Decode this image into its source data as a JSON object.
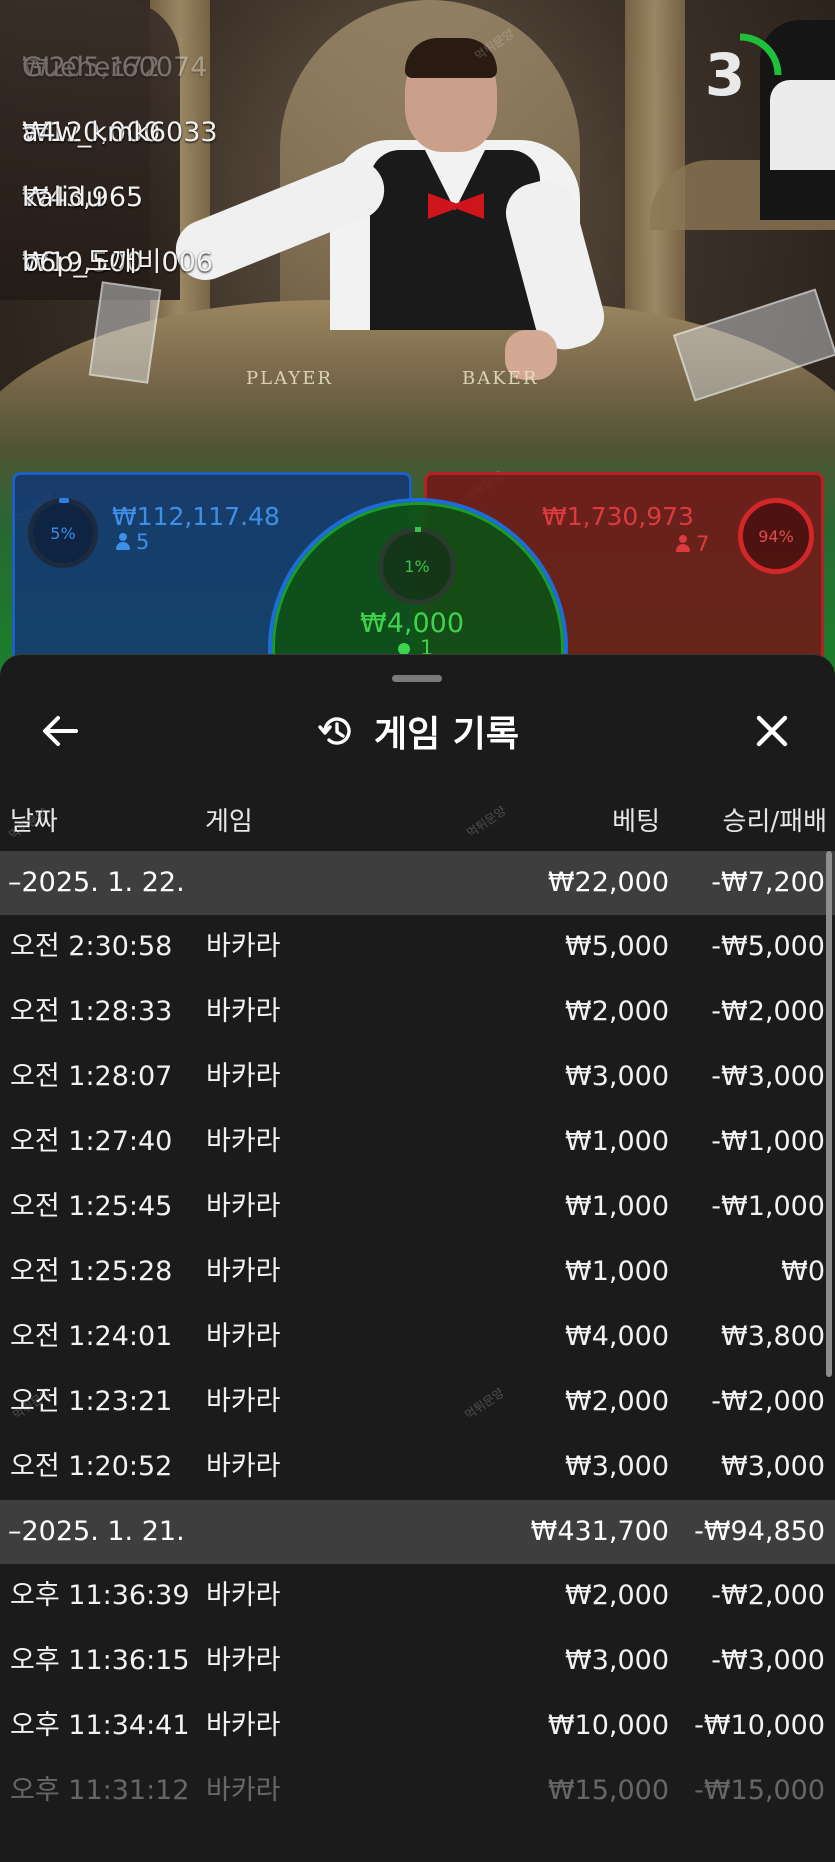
{
  "ticker": [
    {
      "amount": "₩205,172",
      "user": "Gueher60074"
    },
    {
      "amount": "₩120,000",
      "user": "a4w_kmk6033"
    },
    {
      "amount": "₩43,965",
      "user": "kalidu"
    },
    {
      "amount": "₩19,500",
      "user": "b6p_도깨비006"
    }
  ],
  "countdown": {
    "value": "3",
    "progress": 0.25
  },
  "table_labels": {
    "player": "PLAYER",
    "banker": "BAKER"
  },
  "watermark": "먹튀문양",
  "bet_spots": {
    "player": {
      "percent": "5%",
      "amount": "₩112,117.48",
      "players": "5",
      "color": "#3e8fe8"
    },
    "banker": {
      "percent": "94%",
      "amount": "₩1,730,973",
      "players": "7",
      "color": "#dd3a3f"
    },
    "tie": {
      "percent": "1%",
      "amount": "₩4,000",
      "players": "1",
      "color": "#3fd24e"
    }
  },
  "sheet": {
    "title": "게임 기록",
    "columns": {
      "date": "날짜",
      "game": "게임",
      "bet": "베팅",
      "result": "승리/패배"
    },
    "groups": [
      {
        "date": "–2025. 1. 22.",
        "bet": "₩22,000",
        "result": "-₩7,200",
        "rows": [
          {
            "time": "오전 2:30:58",
            "game": "바카라",
            "bet": "₩5,000",
            "result": "-₩5,000"
          },
          {
            "time": "오전 1:28:33",
            "game": "바카라",
            "bet": "₩2,000",
            "result": "-₩2,000"
          },
          {
            "time": "오전 1:28:07",
            "game": "바카라",
            "bet": "₩3,000",
            "result": "-₩3,000"
          },
          {
            "time": "오전 1:27:40",
            "game": "바카라",
            "bet": "₩1,000",
            "result": "-₩1,000"
          },
          {
            "time": "오전 1:25:45",
            "game": "바카라",
            "bet": "₩1,000",
            "result": "-₩1,000"
          },
          {
            "time": "오전 1:25:28",
            "game": "바카라",
            "bet": "₩1,000",
            "result": "₩0"
          },
          {
            "time": "오전 1:24:01",
            "game": "바카라",
            "bet": "₩4,000",
            "result": "₩3,800"
          },
          {
            "time": "오전 1:23:21",
            "game": "바카라",
            "bet": "₩2,000",
            "result": "-₩2,000"
          },
          {
            "time": "오전 1:20:52",
            "game": "바카라",
            "bet": "₩3,000",
            "result": "₩3,000"
          }
        ]
      },
      {
        "date": "–2025. 1. 21.",
        "bet": "₩431,700",
        "result": "-₩94,850",
        "rows": [
          {
            "time": "오후 11:36:39",
            "game": "바카라",
            "bet": "₩2,000",
            "result": "-₩2,000"
          },
          {
            "time": "오후 11:36:15",
            "game": "바카라",
            "bet": "₩3,000",
            "result": "-₩3,000"
          },
          {
            "time": "오후 11:34:41",
            "game": "바카라",
            "bet": "₩10,000",
            "result": "-₩10,000"
          },
          {
            "time": "오후 11:31:12",
            "game": "바카라",
            "bet": "₩15,000",
            "result": "-₩15,000"
          }
        ]
      }
    ]
  }
}
